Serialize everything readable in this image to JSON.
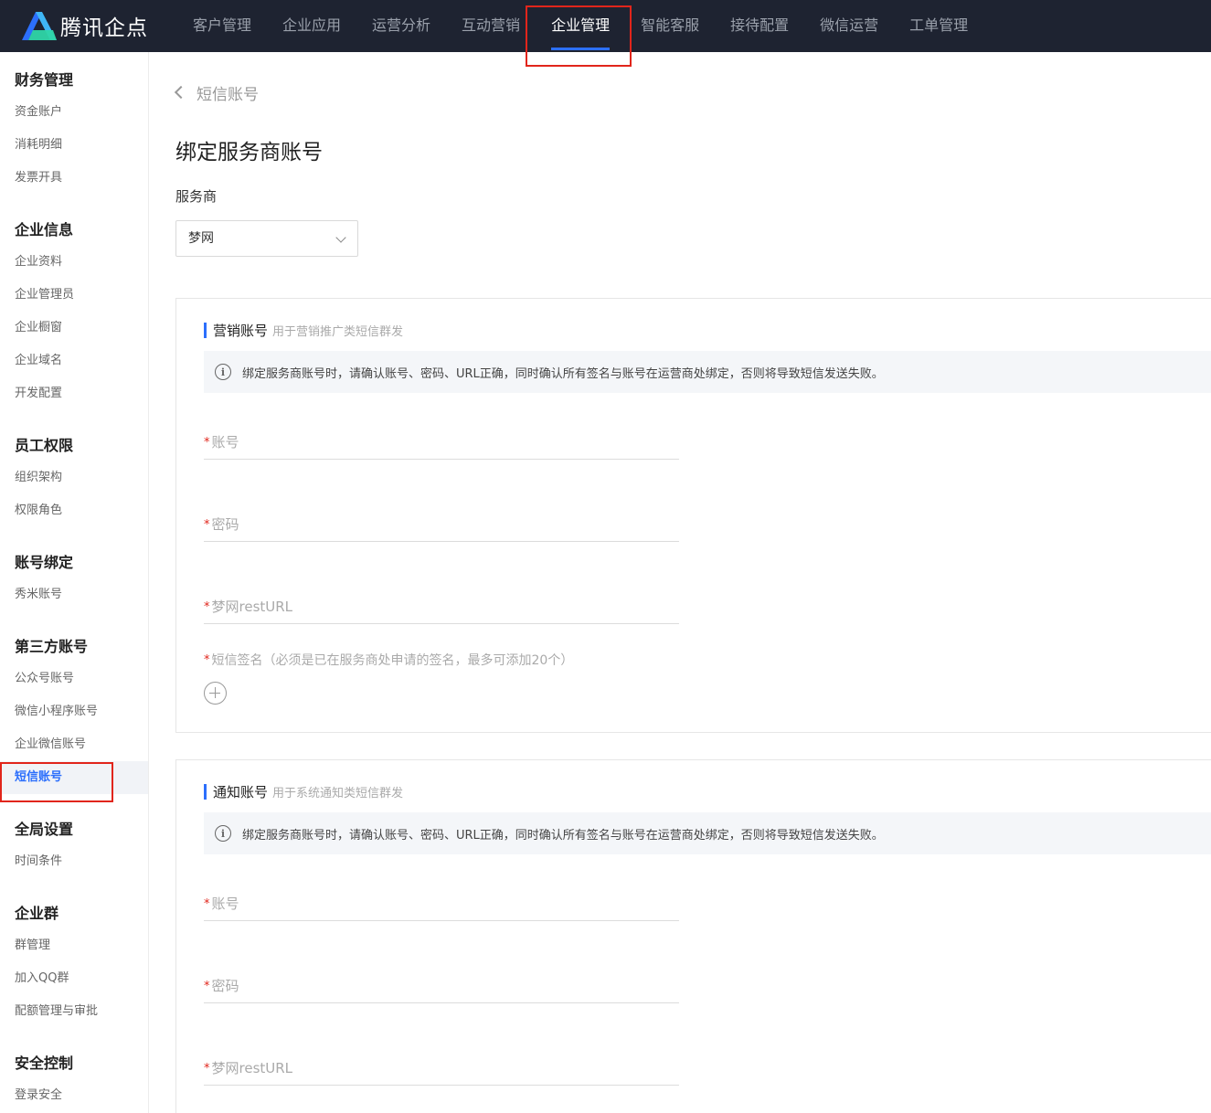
{
  "app": {
    "name": "腾讯企点"
  },
  "topnav": [
    "客户管理",
    "企业应用",
    "运营分析",
    "互动营销",
    "企业管理",
    "智能客服",
    "接待配置",
    "微信运营",
    "工单管理"
  ],
  "sidebar": {
    "groups": [
      {
        "title": "财务管理",
        "items": [
          "资金账户",
          "消耗明细",
          "发票开具"
        ]
      },
      {
        "title": "企业信息",
        "items": [
          "企业资料",
          "企业管理员",
          "企业橱窗",
          "企业域名",
          "开发配置"
        ]
      },
      {
        "title": "员工权限",
        "items": [
          "组织架构",
          "权限角色"
        ]
      },
      {
        "title": "账号绑定",
        "items": [
          "秀米账号"
        ]
      },
      {
        "title": "第三方账号",
        "items": [
          "公众号账号",
          "微信小程序账号",
          "企业微信账号",
          "短信账号"
        ]
      },
      {
        "title": "全局设置",
        "items": [
          "时间条件"
        ]
      },
      {
        "title": "企业群",
        "items": [
          "群管理",
          "加入QQ群",
          "配额管理与审批"
        ]
      },
      {
        "title": "安全控制",
        "items": [
          "登录安全"
        ]
      }
    ],
    "active_item": "短信账号"
  },
  "main": {
    "back_label": "短信账号",
    "title": "绑定服务商账号",
    "provider_label": "服务商",
    "provider_value": "梦网",
    "marketing": {
      "title": "营销账号",
      "subtitle": "用于营销推广类短信群发",
      "notice": "绑定服务商账号时，请确认账号、密码、URL正确，同时确认所有签名与账号在运营商处绑定，否则将导致短信发送失败。",
      "account_placeholder": "账号",
      "password_placeholder": "密码",
      "url_placeholder": "梦网restURL",
      "signature_label": "短信签名（必须是已在服务商处申请的签名，最多可添加20个）"
    },
    "notification": {
      "title": "通知账号",
      "subtitle": "用于系统通知类短信群发",
      "notice": "绑定服务商账号时，请确认账号、密码、URL正确，同时确认所有签名与账号在运营商处绑定，否则将导致短信发送失败。",
      "account_placeholder": "账号",
      "password_placeholder": "密码",
      "url_placeholder": "梦网restURL"
    },
    "required_mark": "*"
  },
  "colors": {
    "topbar": "#1e2331",
    "accent": "#2c6ffc",
    "highlight": "#e1251b"
  },
  "icons": {
    "logo": "tencent-qidian-logo",
    "back": "chevron-left-icon",
    "info": "info-circle-icon",
    "add": "add-circle-icon",
    "dropdown": "chevron-down-icon"
  }
}
